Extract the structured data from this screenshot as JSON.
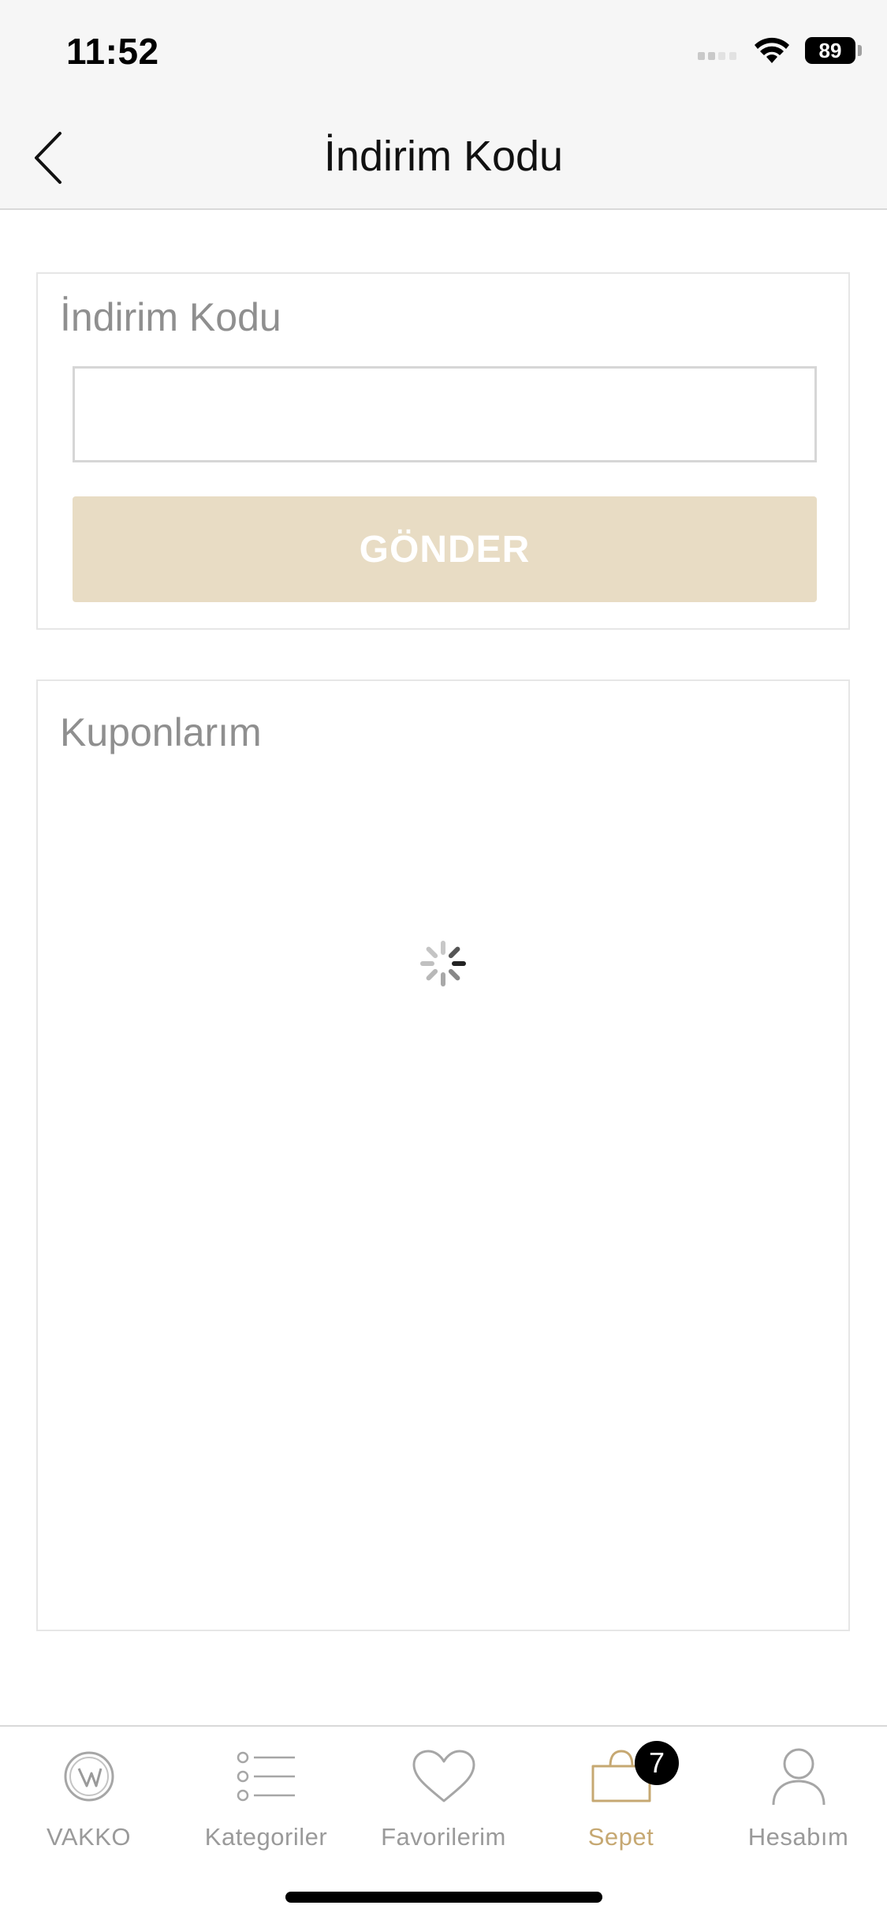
{
  "status_bar": {
    "time": "11:52",
    "battery": "89",
    "icons": [
      "signal-icon",
      "wifi-icon",
      "battery-icon"
    ]
  },
  "nav": {
    "title": "İndirim Kodu",
    "back_icon": "chevron-left-icon"
  },
  "discount_code": {
    "title": "İndirim Kodu",
    "input_value": "",
    "input_placeholder": "",
    "submit_label": "GÖNDER",
    "submit_color": "#e8dcc4"
  },
  "coupons": {
    "title": "Kuponlarım",
    "loading_icon": "loading-spinner-icon"
  },
  "tabs": [
    {
      "label": "VAKKO",
      "icon": "vakko-logo-icon"
    },
    {
      "label": "Kategoriler",
      "icon": "list-icon"
    },
    {
      "label": "Favorilerim",
      "icon": "heart-icon"
    },
    {
      "label": "Sepet",
      "icon": "shopping-bag-icon",
      "badge": "7",
      "active": true
    },
    {
      "label": "Hesabım",
      "icon": "user-icon"
    }
  ],
  "colors": {
    "accent": "#c6a872",
    "inactive": "#9a9a9a",
    "badge": "#000000"
  }
}
